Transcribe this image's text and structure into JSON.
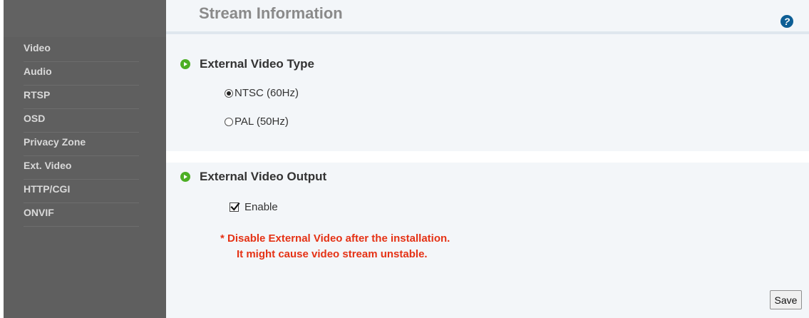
{
  "sidebar": {
    "items": [
      {
        "label": "Video"
      },
      {
        "label": "Audio"
      },
      {
        "label": "RTSP"
      },
      {
        "label": "OSD"
      },
      {
        "label": "Privacy Zone"
      },
      {
        "label": "Ext. Video"
      },
      {
        "label": "HTTP/CGI"
      },
      {
        "label": "ONVIF"
      }
    ]
  },
  "header": {
    "title": "Stream Information",
    "help_icon": "?"
  },
  "ext_video_type": {
    "heading": "External Video Type",
    "options": [
      {
        "label": "NTSC (60Hz)",
        "checked": true
      },
      {
        "label": "PAL (50Hz)",
        "checked": false
      }
    ]
  },
  "ext_video_output": {
    "heading": "External Video Output",
    "enable_label": "Enable",
    "enable_checked": true,
    "warning_line1": "* Disable External Video after the installation.",
    "warning_line2": "It might cause video stream unstable."
  },
  "footer": {
    "save_label": "Save"
  },
  "colors": {
    "sidebar_bg": "#5f5f5f",
    "sidebar_text": "#d9d9d9",
    "content_bg": "#f3f6f9",
    "accent_green": "#4cae24",
    "warning_red": "#e53215",
    "help_blue": "#0d5e95"
  },
  "icons": {
    "section_bullet": "green-circle-arrow-icon",
    "help": "question-circle-icon"
  }
}
